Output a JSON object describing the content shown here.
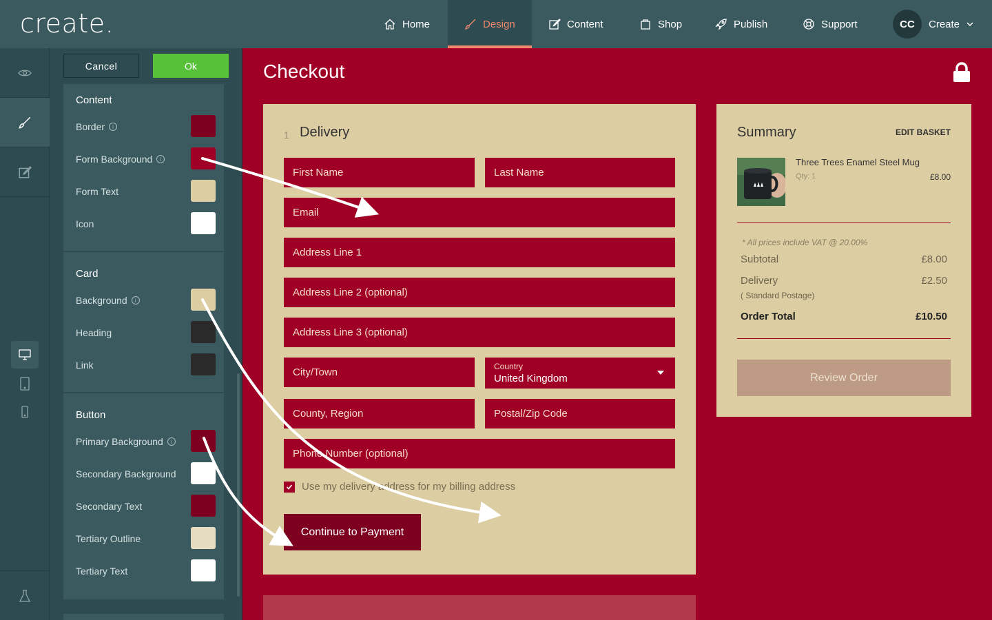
{
  "brand": {
    "logo": "create."
  },
  "nav": [
    {
      "label": "Home",
      "icon": "home-icon"
    },
    {
      "label": "Design",
      "icon": "brush-icon",
      "active": true
    },
    {
      "label": "Content",
      "icon": "edit-icon"
    },
    {
      "label": "Shop",
      "icon": "bag-icon"
    },
    {
      "label": "Publish",
      "icon": "rocket-icon"
    },
    {
      "label": "Support",
      "icon": "lifebuoy-icon"
    }
  ],
  "user": {
    "initials": "CC",
    "menu_label": "Create"
  },
  "panel": {
    "cancel_label": "Cancel",
    "ok_label": "Ok",
    "groups": [
      {
        "title": "Content",
        "rows": [
          {
            "label": "Border",
            "info": true,
            "color": "#7e0020"
          },
          {
            "label": "Form Background",
            "info": true,
            "color": "#a10026"
          },
          {
            "label": "Form Text",
            "info": false,
            "color": "#dccda3"
          },
          {
            "label": "Icon",
            "info": false,
            "color": "#ffffff"
          }
        ]
      },
      {
        "title": "Card",
        "rows": [
          {
            "label": "Background",
            "info": true,
            "color": "#dccda3"
          },
          {
            "label": "Heading",
            "info": false,
            "color": "#2a2a2a"
          },
          {
            "label": "Link",
            "info": false,
            "color": "#2a2a2a"
          }
        ]
      },
      {
        "title": "Button",
        "rows": [
          {
            "label": "Primary Background",
            "info": true,
            "color": "#7e0020"
          },
          {
            "label": "Secondary Background",
            "info": false,
            "color": "#ffffff"
          },
          {
            "label": "Secondary Text",
            "info": false,
            "color": "#7e0020"
          },
          {
            "label": "Tertiary Outline",
            "info": false,
            "color": "#e6dcc2"
          },
          {
            "label": "Tertiary Text",
            "info": false,
            "color": "#ffffff"
          }
        ]
      }
    ]
  },
  "checkout": {
    "title": "Checkout",
    "step_number": "1",
    "step_title": "Delivery",
    "fields": {
      "first_name": "First Name",
      "last_name": "Last Name",
      "email": "Email",
      "address1": "Address Line 1",
      "address2": "Address Line 2 (optional)",
      "address3": "Address Line 3 (optional)",
      "city": "City/Town",
      "country_label": "Country",
      "country_value": "United Kingdom",
      "county": "County, Region",
      "postal": "Postal/Zip Code",
      "phone": "Phone Number (optional)"
    },
    "billing_checkbox_label": "Use my delivery address for my billing address",
    "billing_checked": true,
    "continue_label": "Continue to Payment"
  },
  "summary": {
    "title": "Summary",
    "edit_basket": "EDIT BASKET",
    "item": {
      "name": "Three Trees Enamel Steel Mug",
      "qty": "Qty: 1",
      "price": "£8.00"
    },
    "vat_note": "* All prices include VAT @ 20.00%",
    "subtotal_label": "Subtotal",
    "subtotal_value": "£8.00",
    "delivery_label": "Delivery",
    "delivery_value": "£2.50",
    "delivery_method": "( Standard Postage)",
    "total_label": "Order Total",
    "total_value": "£10.50",
    "review_label": "Review Order"
  },
  "colors": {
    "topbar": "#3b5a5f",
    "accent_active": "#f08a6e",
    "ok_green": "#57c13a",
    "brand_red": "#a10026",
    "card_beige": "#dccda3"
  }
}
